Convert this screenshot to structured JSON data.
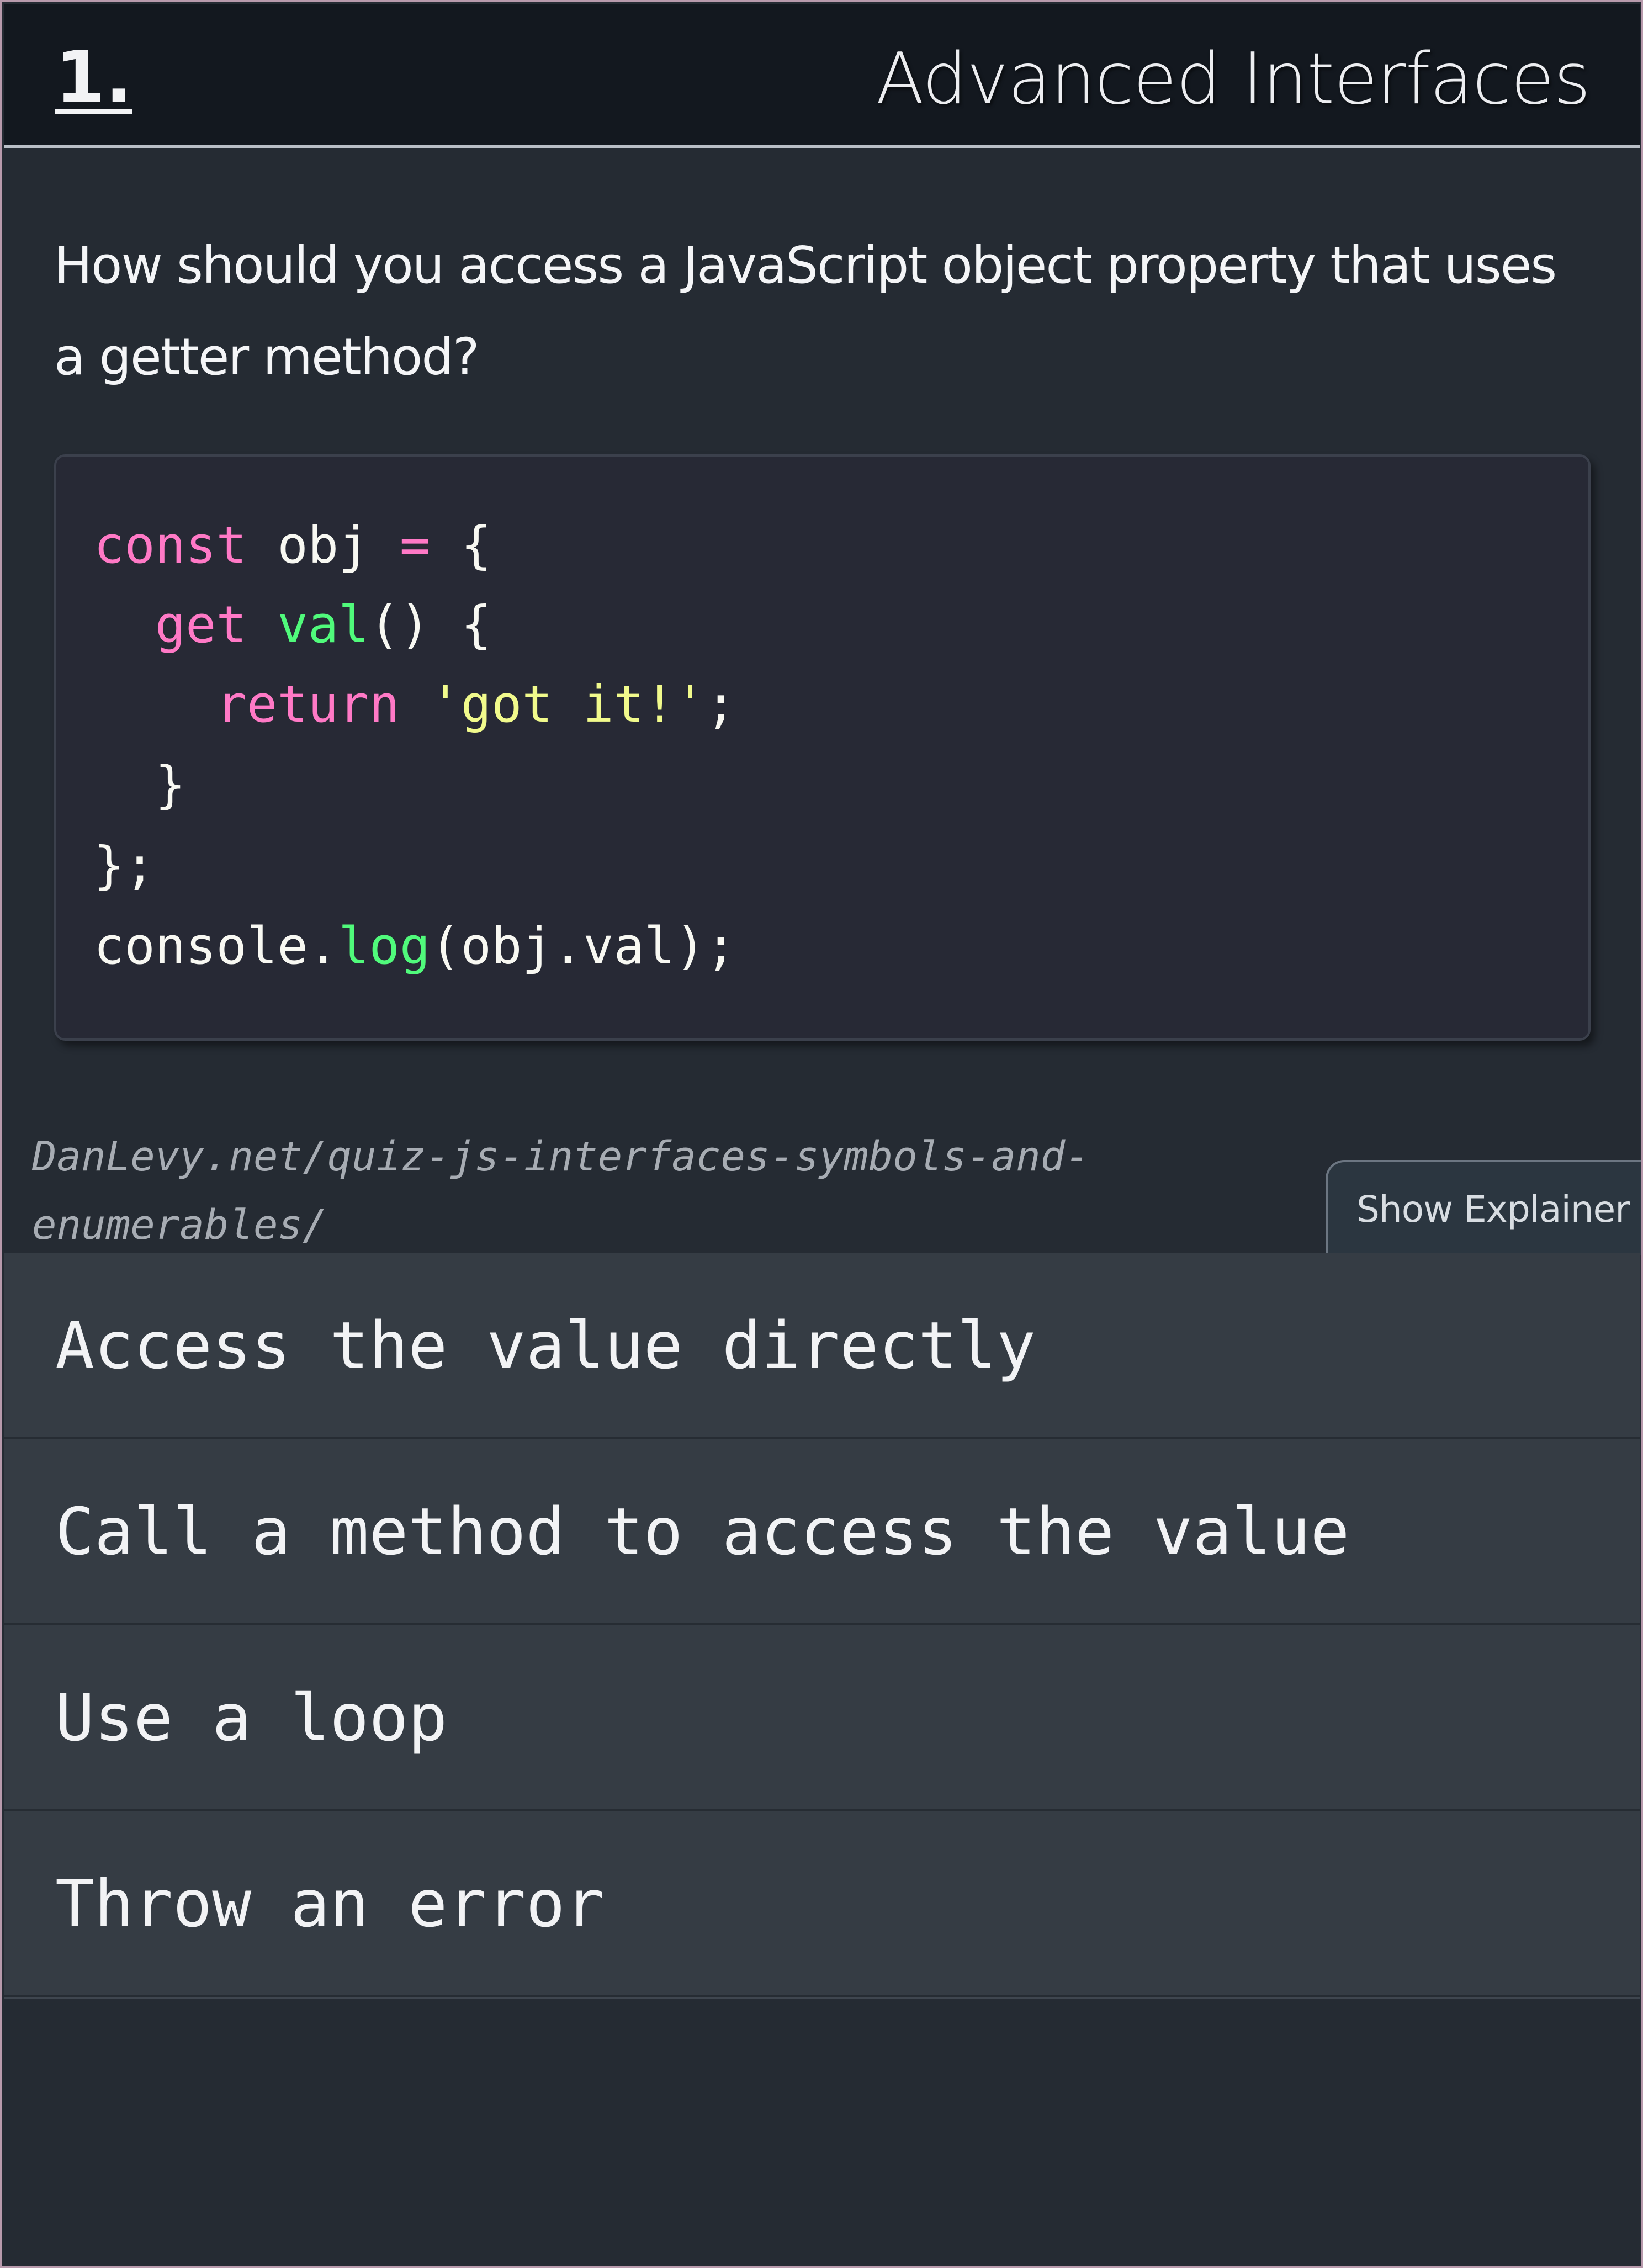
{
  "header": {
    "number": "1.",
    "title": "Advanced Interfaces"
  },
  "question": {
    "text": "How should you access a JavaScript object property that uses a getter method?"
  },
  "code": {
    "lines": [
      [
        [
          "kw",
          "const"
        ],
        [
          "plain",
          " obj "
        ],
        [
          "op",
          "="
        ],
        [
          "plain",
          " {"
        ]
      ],
      [
        [
          "plain",
          "  "
        ],
        [
          "kw",
          "get"
        ],
        [
          "plain",
          " "
        ],
        [
          "fn",
          "val"
        ],
        [
          "plain",
          "() {"
        ]
      ],
      [
        [
          "plain",
          "    "
        ],
        [
          "kw",
          "return"
        ],
        [
          "plain",
          " "
        ],
        [
          "str",
          "'got it!'"
        ],
        [
          "plain",
          ";"
        ]
      ],
      [
        [
          "plain",
          "  }"
        ]
      ],
      [
        [
          "plain",
          "};"
        ]
      ],
      [
        [
          "plain",
          "console."
        ],
        [
          "fn",
          "log"
        ],
        [
          "plain",
          "(obj.val);"
        ]
      ]
    ]
  },
  "footer": {
    "source_line1": "DanLevy.net/quiz-js-interfaces-symbols-and-",
    "source_line2": "enumerables/",
    "explainer_label": "Show Explainer"
  },
  "options": [
    "Access the value directly",
    "Call a method to access the value",
    "Use a loop",
    "Throw an error"
  ],
  "colors": {
    "keyword": "#ff79c6",
    "function": "#50fa7b",
    "string": "#f1fa8c",
    "background": "#252b33",
    "option_background": "#353c44"
  }
}
